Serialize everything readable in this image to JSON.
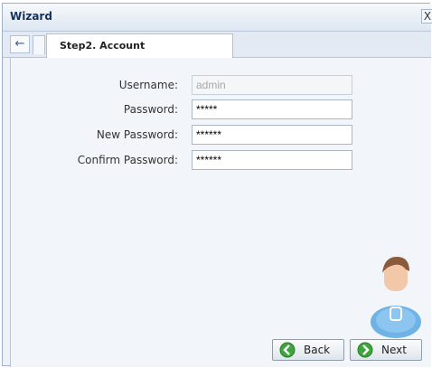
{
  "window": {
    "title": "Wizard",
    "close_glyph": "X"
  },
  "tabs": {
    "back_glyph": "←",
    "active_label": "Step2. Account"
  },
  "form": {
    "fields": [
      {
        "label": "Username:",
        "value": "admin",
        "disabled": true
      },
      {
        "label": "Password:",
        "value": "*****"
      },
      {
        "label": "New Password:",
        "value": "******"
      },
      {
        "label": "Confirm Password:",
        "value": "******"
      }
    ]
  },
  "buttons": {
    "back_label": "Back",
    "next_label": "Next"
  },
  "icons": {
    "close": "close-icon",
    "tab_back": "arrow-left-icon",
    "back": "green-arrow-left-icon",
    "next": "green-arrow-right-icon",
    "avatar": "user-twitter-avatar-icon"
  },
  "colors": {
    "title_text": "#15325f",
    "content_bg": "#f2f5f9",
    "button_icon_green": "#3ea43e",
    "avatar_body": "#6fb2e6"
  }
}
